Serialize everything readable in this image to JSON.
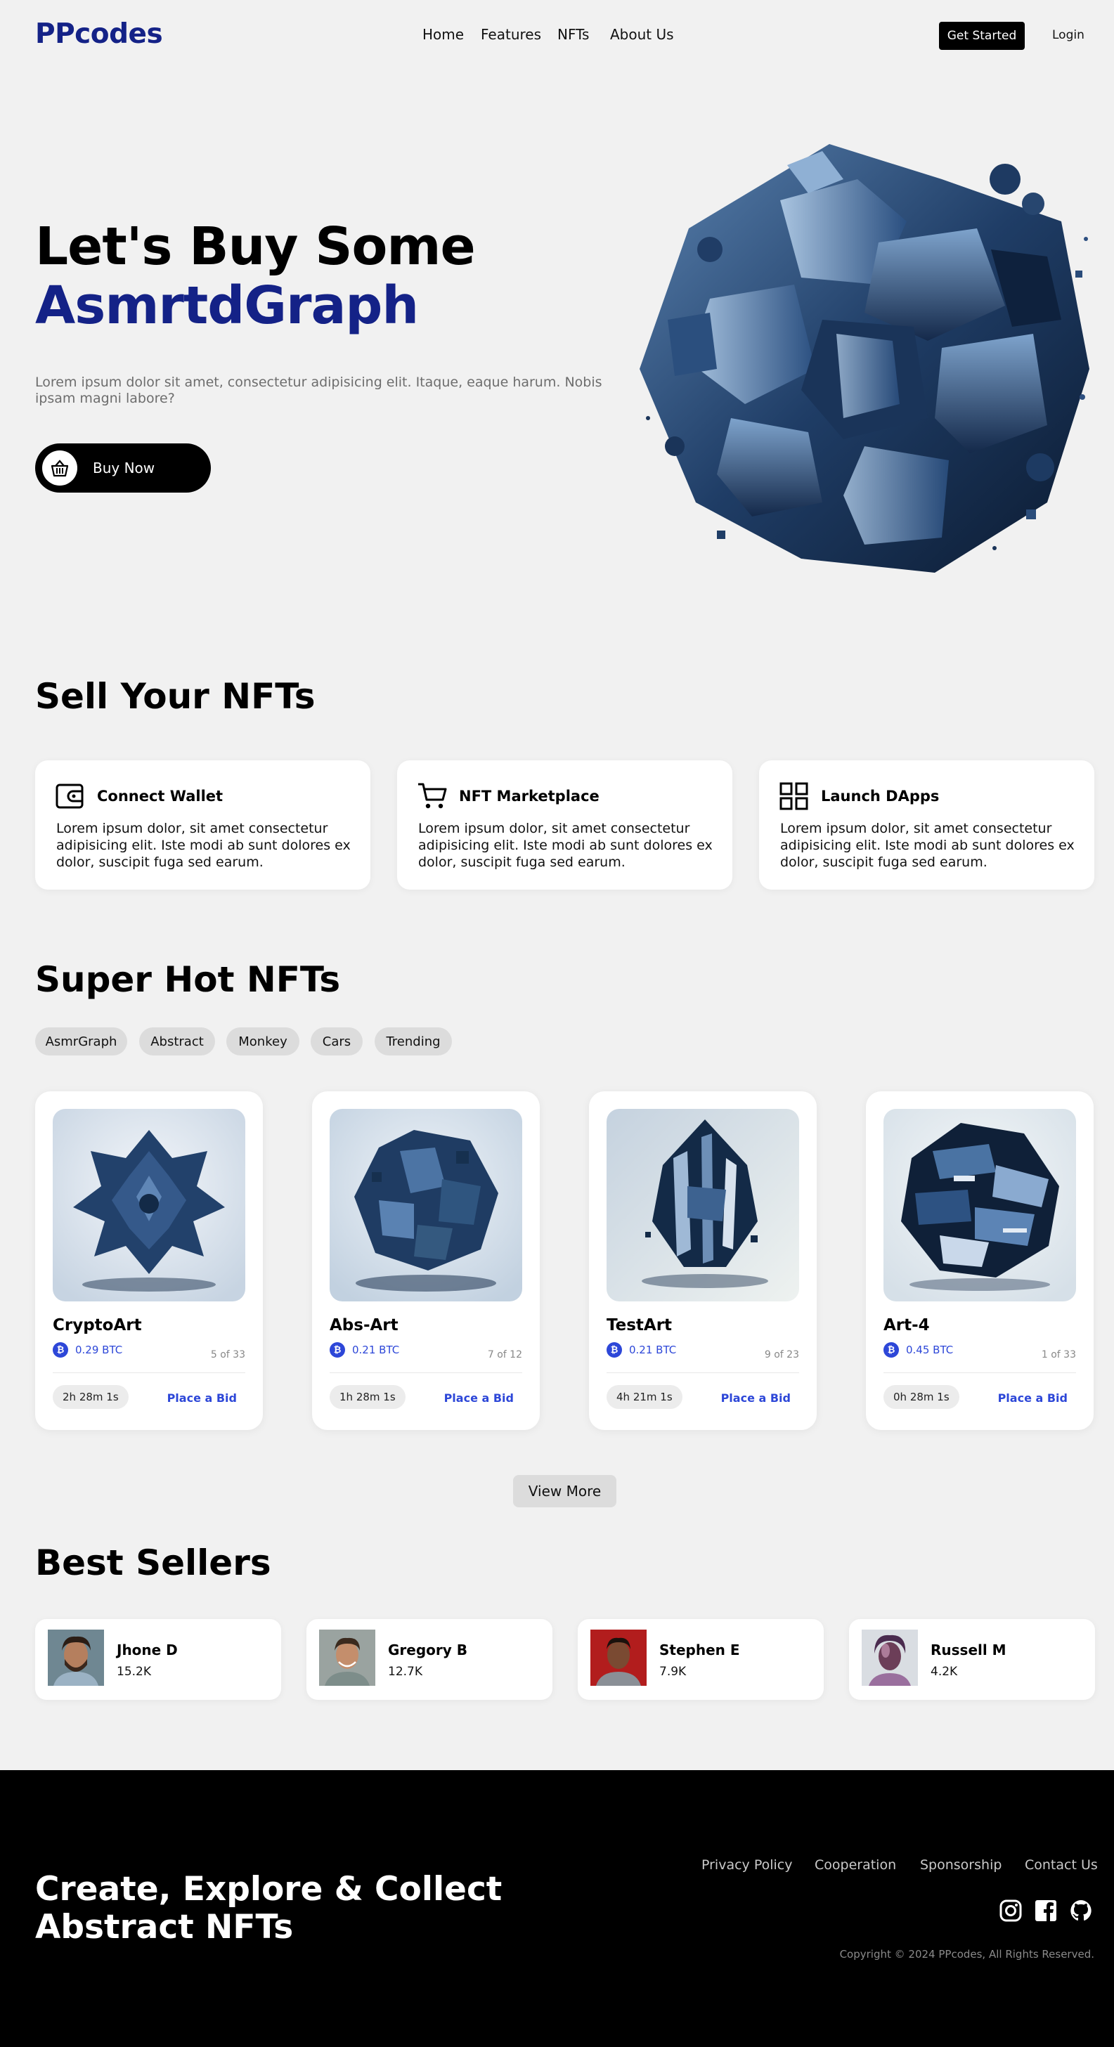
{
  "brand": {
    "logo": "PPcodes",
    "accent": "#142287",
    "link_blue": "#2d47d8"
  },
  "nav": {
    "links": [
      "Home",
      "Features",
      "NFTs",
      "About Us"
    ],
    "get_started": "Get Started",
    "login": "Login"
  },
  "hero": {
    "title_line1": "Let's Buy Some",
    "title_line2": "AsmrtdGraph",
    "description": "Lorem ipsum dolor sit amet, consectetur adipisicing elit. Itaque, eaque harum. Nobis ipsam magni labore?",
    "cta": "Buy Now",
    "cta_icon": "basket-icon"
  },
  "sell": {
    "title": "Sell Your NFTs",
    "cards": [
      {
        "icon": "wallet-icon",
        "title": "Connect Wallet",
        "text": "Lorem ipsum dolor, sit amet consectetur adipisicing elit. Iste modi ab sunt dolores ex dolor, suscipit fuga sed earum."
      },
      {
        "icon": "cart-icon",
        "title": "NFT Marketplace",
        "text": "Lorem ipsum dolor, sit amet consectetur adipisicing elit. Iste modi ab sunt dolores ex dolor, suscipit fuga sed earum."
      },
      {
        "icon": "grid-icon",
        "title": "Launch DApps",
        "text": "Lorem ipsum dolor, sit amet consectetur adipisicing elit. Iste modi ab sunt dolores ex dolor, suscipit fuga sed earum."
      }
    ]
  },
  "hot": {
    "title": "Super Hot NFTs",
    "categories": [
      "AsmrGraph",
      "Abstract",
      "Monkey",
      "Cars",
      "Trending"
    ],
    "items": [
      {
        "name": "CryptoArt",
        "price": "0.29 BTC",
        "edition": "5 of 33",
        "time": "2h 28m 1s",
        "bid": "Place a Bid",
        "btc_symbol": "₿"
      },
      {
        "name": "Abs-Art",
        "price": "0.21 BTC",
        "edition": "7 of 12",
        "time": "1h 28m 1s",
        "bid": "Place a Bid",
        "btc_symbol": "₿"
      },
      {
        "name": "TestArt",
        "price": "0.21 BTC",
        "edition": "9 of 23",
        "time": "4h 21m 1s",
        "bid": "Place a Bid",
        "btc_symbol": "₿"
      },
      {
        "name": "Art-4",
        "price": "0.45 BTC",
        "edition": "1 of 33",
        "time": "0h 28m 1s",
        "bid": "Place a Bid",
        "btc_symbol": "₿"
      }
    ],
    "view_more": "View More"
  },
  "sellers": {
    "title": "Best Sellers",
    "items": [
      {
        "name": "Jhone D",
        "value": "15.2K"
      },
      {
        "name": "Gregory B",
        "value": "12.7K"
      },
      {
        "name": "Stephen E",
        "value": "7.9K"
      },
      {
        "name": "Russell M",
        "value": "4.2K"
      }
    ]
  },
  "footer": {
    "tagline_line1": "Create, Explore & Collect",
    "tagline_line2": "Abstract NFTs",
    "links": [
      "Privacy Policy",
      "Cooperation",
      "Sponsorship",
      "Contact Us"
    ],
    "social": [
      "instagram-icon",
      "facebook-icon",
      "github-icon"
    ],
    "copyright": "Copyright © 2024 PPcodes, All Rights Reserved."
  }
}
